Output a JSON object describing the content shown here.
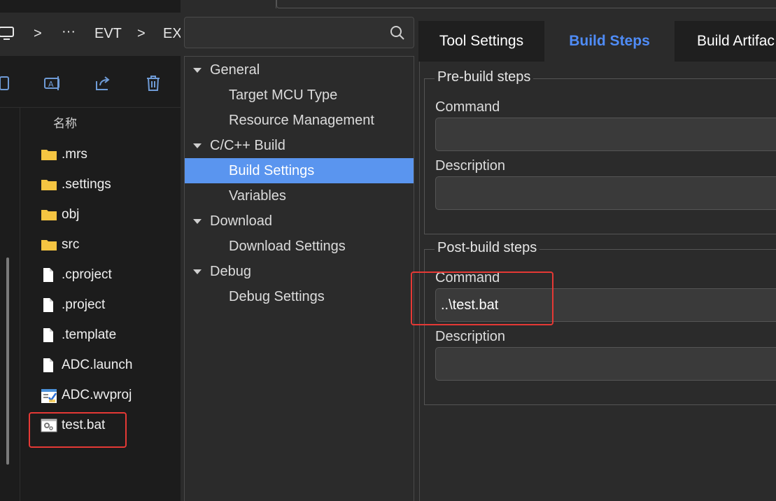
{
  "explorer": {
    "breadcrumb": {
      "chevron1": ">",
      "ellipsis": "···",
      "item1": "EVT",
      "chevron2": ">",
      "item2": "EX"
    },
    "column_header": "名称",
    "files": [
      {
        "name": ".mrs",
        "icon": "folder-icon"
      },
      {
        "name": ".settings",
        "icon": "folder-icon"
      },
      {
        "name": "obj",
        "icon": "folder-icon"
      },
      {
        "name": "src",
        "icon": "folder-icon"
      },
      {
        "name": ".cproject",
        "icon": "file-icon"
      },
      {
        "name": ".project",
        "icon": "file-icon"
      },
      {
        "name": ".template",
        "icon": "file-icon"
      },
      {
        "name": "ADC.launch",
        "icon": "file-icon"
      },
      {
        "name": "ADC.wvproj",
        "icon": "project-file-icon"
      },
      {
        "name": "test.bat",
        "icon": "batch-file-icon"
      }
    ],
    "colors": {
      "folder": "#f5c542",
      "highlight": "#e53935"
    }
  },
  "tree": {
    "search_placeholder": "",
    "groups": [
      {
        "label": "General",
        "children": [
          "Target MCU Type",
          "Resource Management"
        ]
      },
      {
        "label": "C/C++ Build",
        "children": [
          "Build Settings",
          "Variables"
        ]
      },
      {
        "label": "Download",
        "children": [
          "Download Settings"
        ]
      },
      {
        "label": "Debug",
        "children": [
          "Debug Settings"
        ]
      }
    ],
    "selected": "Build Settings",
    "selected_color": "#5a95ef"
  },
  "panel": {
    "tabs": [
      "Tool Settings",
      "Build Steps",
      "Build Artifac"
    ],
    "active_tab": "Build Steps",
    "accent": "#4f8cf7",
    "pre_build": {
      "title": "Pre-build steps",
      "command_label": "Command",
      "command_value": "",
      "description_label": "Description",
      "description_value": ""
    },
    "post_build": {
      "title": "Post-build steps",
      "command_label": "Command",
      "command_value": "..\\test.bat",
      "description_label": "Description",
      "description_value": ""
    }
  }
}
